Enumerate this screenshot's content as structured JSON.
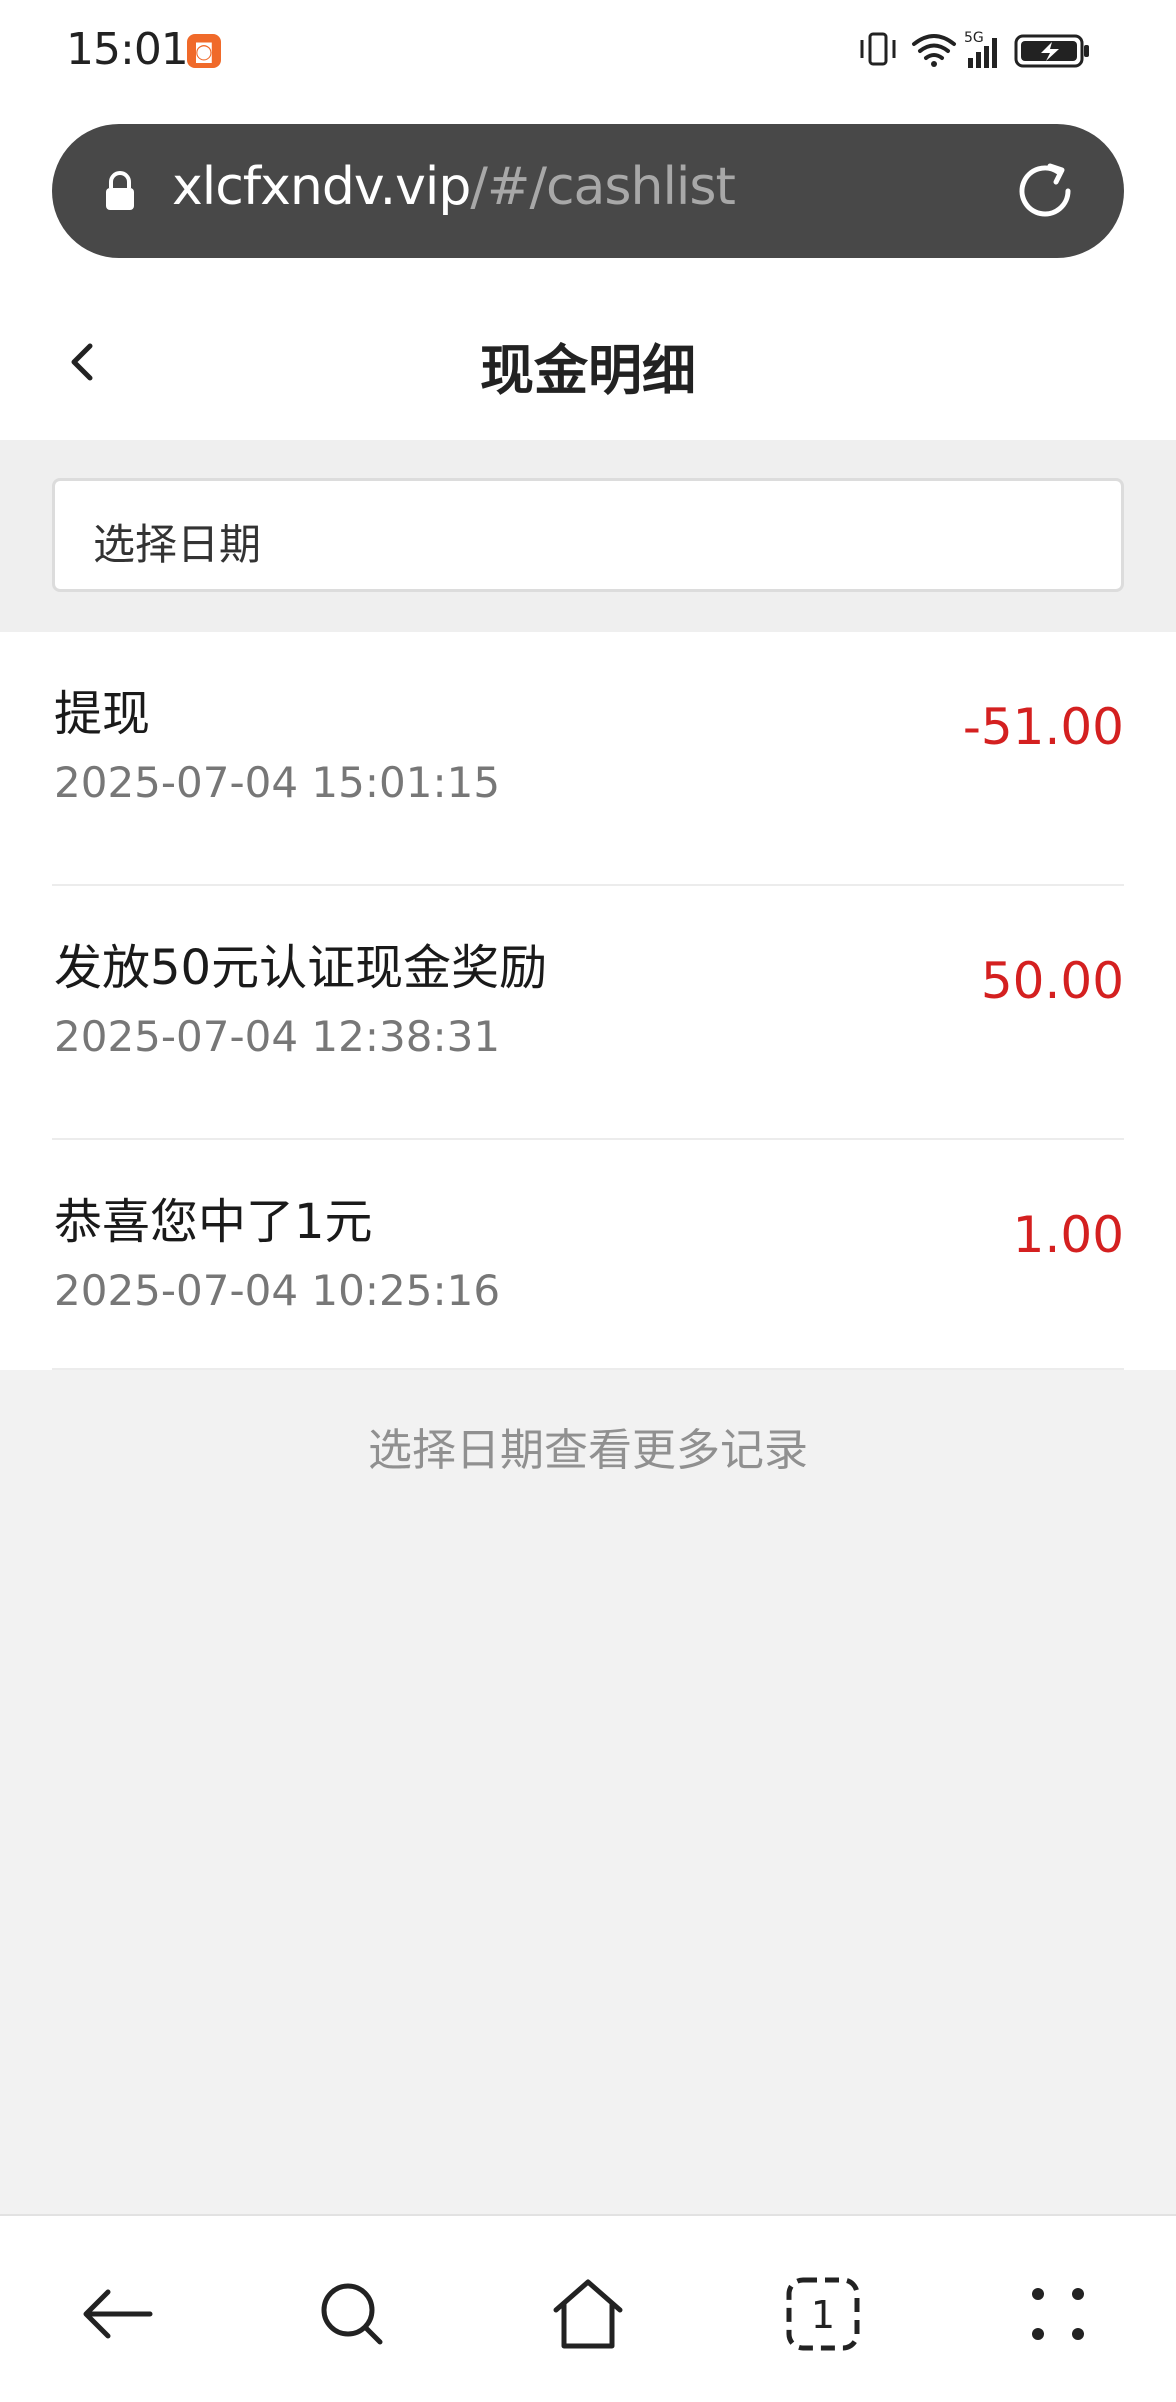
{
  "status_bar": {
    "time": "15:01",
    "app_badge_icon": "app-notification-icon",
    "signal_label": "5G",
    "icons": [
      "vibrate-icon",
      "wifi-icon",
      "signal-5g-icon",
      "battery-charging-icon"
    ]
  },
  "browser": {
    "url_domain": "xlcfxndv.vip",
    "url_path": "/#/cashlist",
    "lock_icon": "lock-icon",
    "reload_icon": "reload-icon"
  },
  "header": {
    "title": "现金明细",
    "back_icon": "back-icon"
  },
  "filter": {
    "date_placeholder": "选择日期"
  },
  "records": [
    {
      "title": "提现",
      "time": "2025-07-04 15:01:15",
      "amount": "-51.00"
    },
    {
      "title": "发放50元认证现金奖励",
      "time": "2025-07-04 12:38:31",
      "amount": "50.00"
    },
    {
      "title": "恭喜您中了1元",
      "time": "2025-07-04 10:25:16",
      "amount": "1.00"
    }
  ],
  "footer_hint": "选择日期查看更多记录",
  "bottom_nav": {
    "tabs_count": "1",
    "icons": [
      "back-arrow-icon",
      "search-icon",
      "home-icon",
      "tabs-icon",
      "more-icon"
    ]
  },
  "colors": {
    "amount": "#d42020",
    "urlbar_bg": "#484848",
    "page_bg": "#f2f2f2"
  }
}
